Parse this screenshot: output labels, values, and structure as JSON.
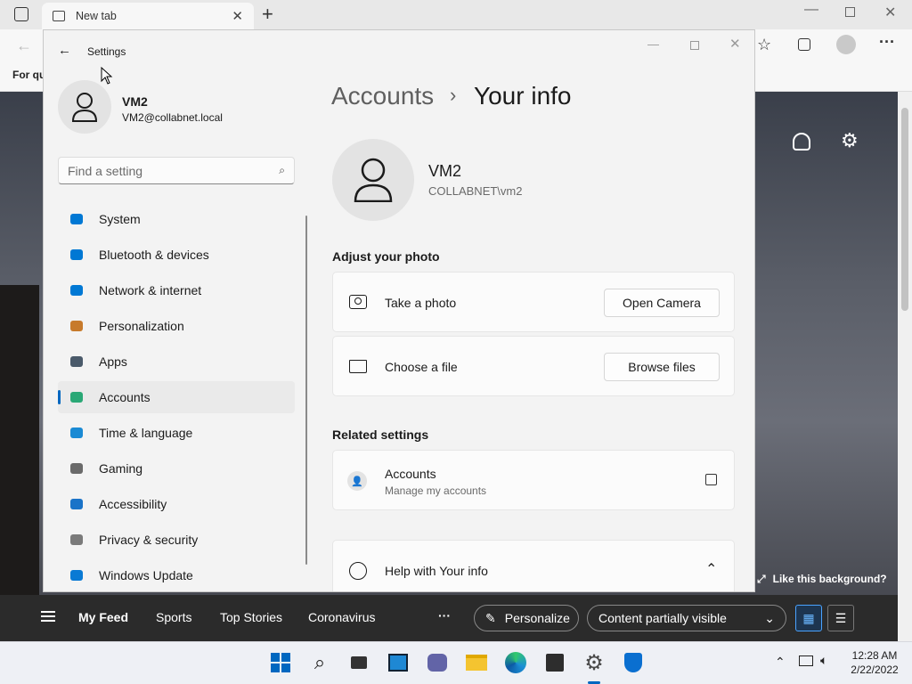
{
  "browser": {
    "tab_title": "New tab",
    "favorites_label": "For qu",
    "like_background": "Like this background?"
  },
  "feed": {
    "items": [
      "My Feed",
      "Sports",
      "Top Stories",
      "Coronavirus"
    ],
    "more": "···",
    "personalize": "Personalize",
    "content_visibility": "Content partially visible"
  },
  "settings": {
    "window_title": "Settings",
    "user_name": "VM2",
    "user_email": "VM2@collabnet.local",
    "search_placeholder": "Find a setting",
    "nav": [
      {
        "label": "System",
        "icon": "system-icon",
        "color": "#0078d4"
      },
      {
        "label": "Bluetooth & devices",
        "icon": "bluetooth-icon",
        "color": "#0078d4"
      },
      {
        "label": "Network & internet",
        "icon": "network-icon",
        "color": "#0078d4"
      },
      {
        "label": "Personalization",
        "icon": "brush-icon",
        "color": "#c77a2b"
      },
      {
        "label": "Apps",
        "icon": "apps-icon",
        "color": "#4a5a6a"
      },
      {
        "label": "Accounts",
        "icon": "accounts-icon",
        "color": "#2aa876"
      },
      {
        "label": "Time & language",
        "icon": "globe-clock-icon",
        "color": "#1a8ad4"
      },
      {
        "label": "Gaming",
        "icon": "gamepad-icon",
        "color": "#6a6a6a"
      },
      {
        "label": "Accessibility",
        "icon": "accessibility-icon",
        "color": "#1a73c8"
      },
      {
        "label": "Privacy & security",
        "icon": "shield-icon",
        "color": "#7a7a7a"
      },
      {
        "label": "Windows Update",
        "icon": "update-icon",
        "color": "#0a7ad4"
      }
    ],
    "selected_nav": "Accounts",
    "breadcrumb_parent": "Accounts",
    "breadcrumb_sep": "›",
    "page_title": "Your info",
    "profile_name": "VM2",
    "profile_domain": "COLLABNET\\vm2",
    "adjust_photo_heading": "Adjust your photo",
    "take_photo_label": "Take a photo",
    "open_camera": "Open Camera",
    "choose_file_label": "Choose a file",
    "browse_files": "Browse files",
    "related_heading": "Related settings",
    "related_title": "Accounts",
    "related_sub": "Manage my accounts",
    "help_label": "Help with Your info"
  },
  "taskbar": {
    "time": "12:28 AM",
    "date": "2/22/2022",
    "accent": "#0067c0"
  }
}
